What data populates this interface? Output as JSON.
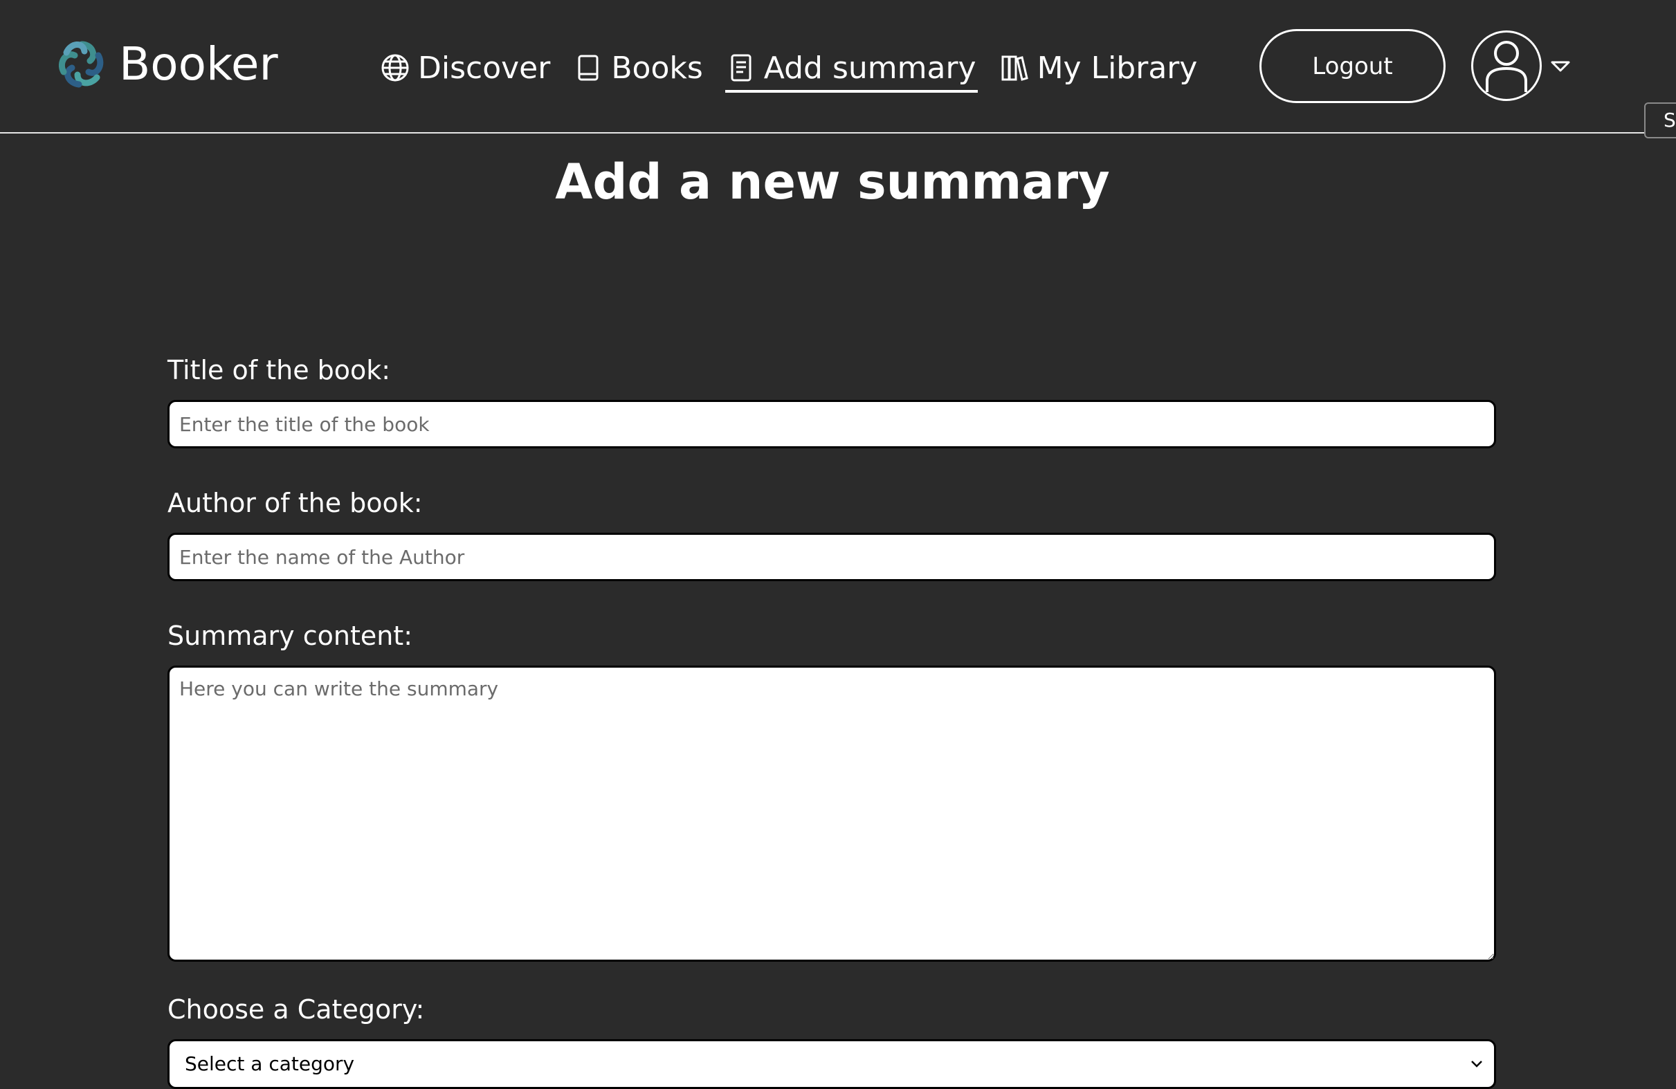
{
  "app": {
    "name": "Booker"
  },
  "nav": {
    "items": [
      {
        "label": "Discover",
        "icon": "globe-icon"
      },
      {
        "label": "Books",
        "icon": "book-icon"
      },
      {
        "label": "Add summary",
        "icon": "document-icon",
        "active": true
      },
      {
        "label": "My Library",
        "icon": "library-icon"
      }
    ]
  },
  "header": {
    "logout_label": "Logout",
    "side_tab_label": "S"
  },
  "page": {
    "title": "Add a new summary"
  },
  "form": {
    "title": {
      "label": "Title of the book:",
      "placeholder": "Enter the title of the book",
      "value": ""
    },
    "author": {
      "label": "Author of the book:",
      "placeholder": "Enter the name of the Author",
      "value": ""
    },
    "summary": {
      "label": "Summary content:",
      "placeholder": "Here you can write the summary",
      "value": ""
    },
    "category": {
      "label": "Choose a Category:",
      "selected": "Select a category"
    }
  },
  "colors": {
    "background": "#2b2b2b",
    "text": "#ffffff",
    "input_background": "#ffffff",
    "logo_teal": "#3f8f8f",
    "logo_blue": "#2d5f87"
  }
}
